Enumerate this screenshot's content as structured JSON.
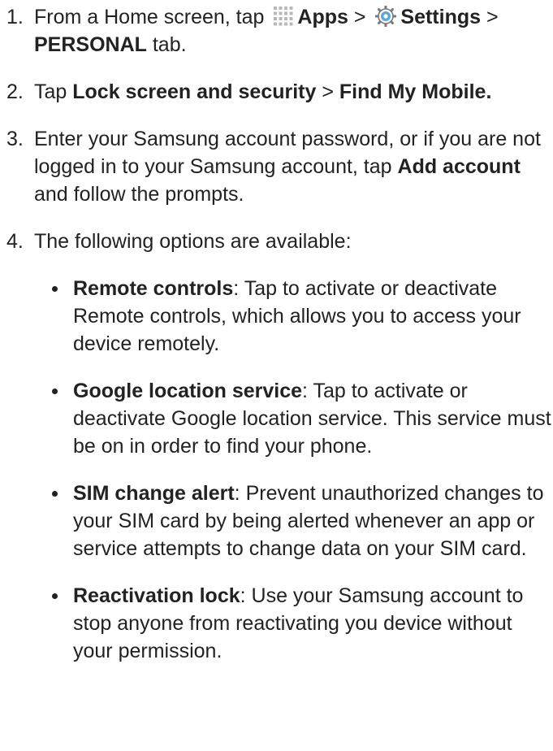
{
  "steps": [
    {
      "num": "1.",
      "runs": [
        {
          "t": "From a Home screen, tap "
        },
        {
          "icon": "apps-icon"
        },
        {
          "t": "Apps",
          "b": true
        },
        {
          "t": " > "
        },
        {
          "icon": "gear-icon"
        },
        {
          "t": "Settings",
          "b": true
        },
        {
          "t": " > "
        },
        {
          "t": "PERSONAL",
          "b": true
        },
        {
          "t": " tab."
        }
      ]
    },
    {
      "num": "2.",
      "runs": [
        {
          "t": "Tap "
        },
        {
          "t": "Lock screen and security",
          "b": true
        },
        {
          "t": " > "
        },
        {
          "t": "Find My Mobile.",
          "b": true
        }
      ]
    },
    {
      "num": "3.",
      "runs": [
        {
          "t": "Enter your Samsung account password, or if you are not logged in to your Samsung account, tap "
        },
        {
          "t": "Add account",
          "b": true
        },
        {
          "t": " and follow the prompts."
        }
      ]
    },
    {
      "num": "4.",
      "runs": [
        {
          "t": "The following options are available:"
        }
      ],
      "options": [
        {
          "term": "Remote controls",
          "text": ": Tap to activate or deactivate Remote controls, which allows you to access your device remotely."
        },
        {
          "term": "Google location service",
          "text": ": Tap to activate or deactivate Google location service. This service must be on in order to find your phone."
        },
        {
          "term": "SIM change alert",
          "text": ": Prevent unauthorized changes to your SIM card by being alerted whenever an app or service attempts to change data on your SIM card."
        },
        {
          "term": "Reactivation lock",
          "text": ": Use your Samsung account to stop anyone from reactivating you device without your permission."
        }
      ]
    }
  ],
  "colors": {
    "text": "#222222",
    "apps_icon": "#b8b8b8",
    "gear_fill": "#5aa9d6",
    "gear_outline": "#7a7a7a"
  }
}
